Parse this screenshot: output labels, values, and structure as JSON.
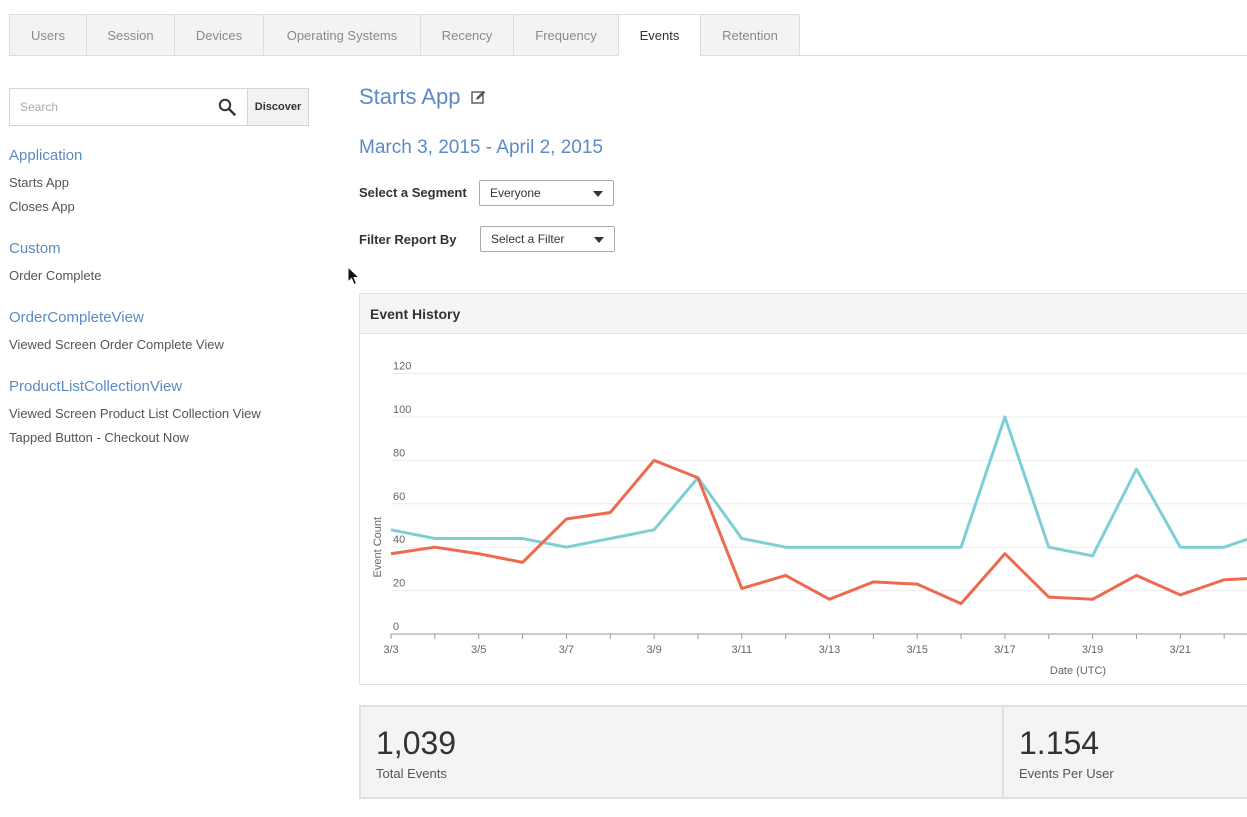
{
  "tabs": [
    "Users",
    "Session",
    "Devices",
    "Operating Systems",
    "Recency",
    "Frequency",
    "Events",
    "Retention"
  ],
  "active_tab": "Events",
  "sidebar": {
    "search_placeholder": "Search",
    "discover_label": "Discover",
    "groups": [
      {
        "title": "Application",
        "items": [
          "Starts App",
          "Closes App"
        ]
      },
      {
        "title": "Custom",
        "items": [
          "Order Complete"
        ]
      },
      {
        "title": "OrderCompleteView",
        "items": [
          "Viewed Screen Order Complete View"
        ]
      },
      {
        "title": "ProductListCollectionView",
        "items": [
          "Viewed Screen Product List Collection View",
          "Tapped Button - Checkout Now"
        ]
      }
    ]
  },
  "main": {
    "title": "Starts App",
    "date_range": "March 3, 2015 - April 2, 2015",
    "segment_label": "Select a Segment",
    "segment_value": "Everyone",
    "filter_label": "Filter Report By",
    "filter_value": "Select a Filter"
  },
  "chart_panel_title": "Event History",
  "chart_data": {
    "type": "line",
    "ylabel": "Event Count",
    "xlabel": "Date (UTC)",
    "ylim": [
      0,
      120
    ],
    "yticks": [
      0,
      20,
      40,
      60,
      80,
      100,
      120
    ],
    "x": [
      "3/3",
      "3/4",
      "3/5",
      "3/6",
      "3/7",
      "3/8",
      "3/9",
      "3/10",
      "3/11",
      "3/12",
      "3/13",
      "3/14",
      "3/15",
      "3/16",
      "3/17",
      "3/18",
      "3/19",
      "3/20",
      "3/21",
      "3/22",
      "3/23"
    ],
    "xtick_labels": [
      "3/3",
      "3/5",
      "3/7",
      "3/9",
      "3/11",
      "3/13",
      "3/15",
      "3/17",
      "3/19",
      "3/21"
    ],
    "series": [
      {
        "color": "#7ecfd4",
        "values": [
          48,
          44,
          44,
          44,
          40,
          44,
          48,
          72,
          44,
          40,
          40,
          40,
          40,
          40,
          100,
          40,
          36,
          76,
          40,
          40,
          47
        ]
      },
      {
        "color": "#ee6a4e",
        "values": [
          37,
          40,
          37,
          33,
          53,
          56,
          80,
          72,
          21,
          27,
          16,
          24,
          23,
          14,
          37,
          17,
          16,
          27,
          18,
          25,
          26
        ]
      }
    ]
  },
  "stats": [
    {
      "value": "1,039",
      "label": "Total Events"
    },
    {
      "value": "1.154",
      "label": "Events Per User"
    }
  ]
}
